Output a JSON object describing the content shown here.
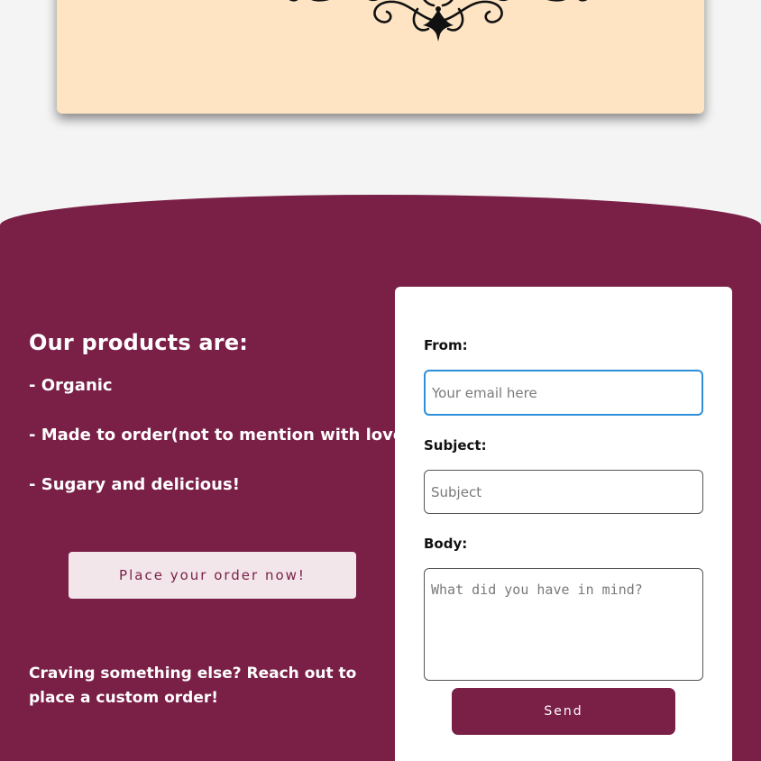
{
  "products": {
    "title": "Our products are:",
    "items": [
      "- Organic",
      "- Made to order(not to mention with love)",
      "- Sugary and delicious!"
    ],
    "order_button_label": "Place your order now!",
    "craving_text": "Craving something else? Reach out to place a custom order!"
  },
  "contact_form": {
    "from_label": "From:",
    "from_placeholder": "Your email here",
    "subject_label": "Subject:",
    "subject_placeholder": "Subject",
    "body_label": "Body:",
    "body_placeholder": "What did you have in mind?",
    "send_label": "Send"
  },
  "colors": {
    "maroon": "#7a1f46",
    "cream": "#fee4c3",
    "focus_blue": "#2f8fd8",
    "button_light": "#f2e6ea"
  },
  "icons": {
    "ornament": "decorative-flourish-icon"
  }
}
